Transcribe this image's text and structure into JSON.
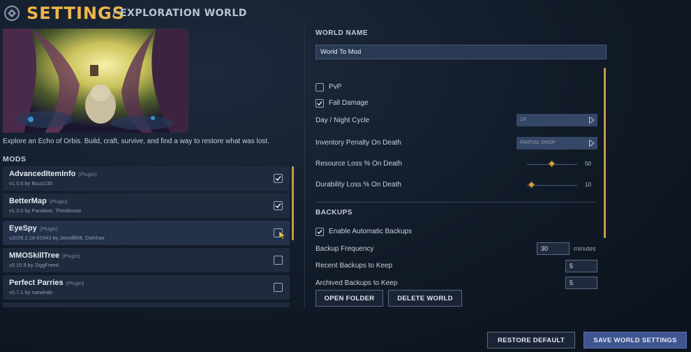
{
  "header": {
    "title": "SETTINGS",
    "subtitle": "/ EXPLORATION WORLD"
  },
  "world": {
    "image_alt": "Forest scene with glowing tree",
    "description": "Explore an Echo of Orbis. Build, craft, survive, and find a way to restore what was lost."
  },
  "mods": {
    "heading": "MODS",
    "items": [
      {
        "name": "AdvancedItemInfo",
        "type": "(Plugin)",
        "author": "v1.0.6 by Buuz135",
        "enabled": true
      },
      {
        "name": "BetterMap",
        "type": "(Plugin)",
        "author": "v1.3.0 by Paralaxe, Theobosse",
        "enabled": true
      },
      {
        "name": "EyeSpy",
        "type": "(Plugin)",
        "author": "v2026.2.18-61643 by Jaredlll08, Darkhax",
        "enabled": false
      },
      {
        "name": "MMOSkillTree",
        "type": "(Plugin)",
        "author": "v0.10.9 by ZiggFreed",
        "enabled": false
      },
      {
        "name": "Perfect Parries",
        "type": "(Plugin)",
        "author": "v0.7.1 by narwhals",
        "enabled": false
      }
    ]
  },
  "world_name": {
    "label": "WORLD NAME",
    "value": "World To Mod"
  },
  "options": {
    "pvp": {
      "label": "PvP",
      "checked": false
    },
    "fall_damage": {
      "label": "Fall Damage",
      "checked": true
    },
    "day_night": {
      "label": "Day / Night Cycle",
      "value": "1X"
    },
    "inventory_penalty": {
      "label": "Inventory Penalty On Death",
      "value": "PARTIAL DROP"
    },
    "resource_loss": {
      "label": "Resource Loss % On Death",
      "value": "50",
      "level": 50
    },
    "durability_loss": {
      "label": "Durability Loss % On Death",
      "value": "10",
      "level": 10
    }
  },
  "backups": {
    "heading": "BACKUPS",
    "enable": {
      "label": "Enable Automatic Backups",
      "checked": true
    },
    "frequency": {
      "label": "Backup Frequency",
      "value": "30",
      "unit": "minutes"
    },
    "recent": {
      "label": "Recent Backups to Keep",
      "value": "5"
    },
    "archived": {
      "label": "Archived Backups to Keep",
      "value": "5"
    }
  },
  "buttons": {
    "open_folder": "OPEN FOLDER",
    "delete_world": "DELETE WORLD",
    "restore_default": "RESTORE DEFAULT",
    "save": "SAVE WORLD SETTINGS"
  },
  "colors": {
    "accent": "#eeb64a",
    "primary_button": "#3e5590",
    "panel": "#1f2b3d"
  }
}
